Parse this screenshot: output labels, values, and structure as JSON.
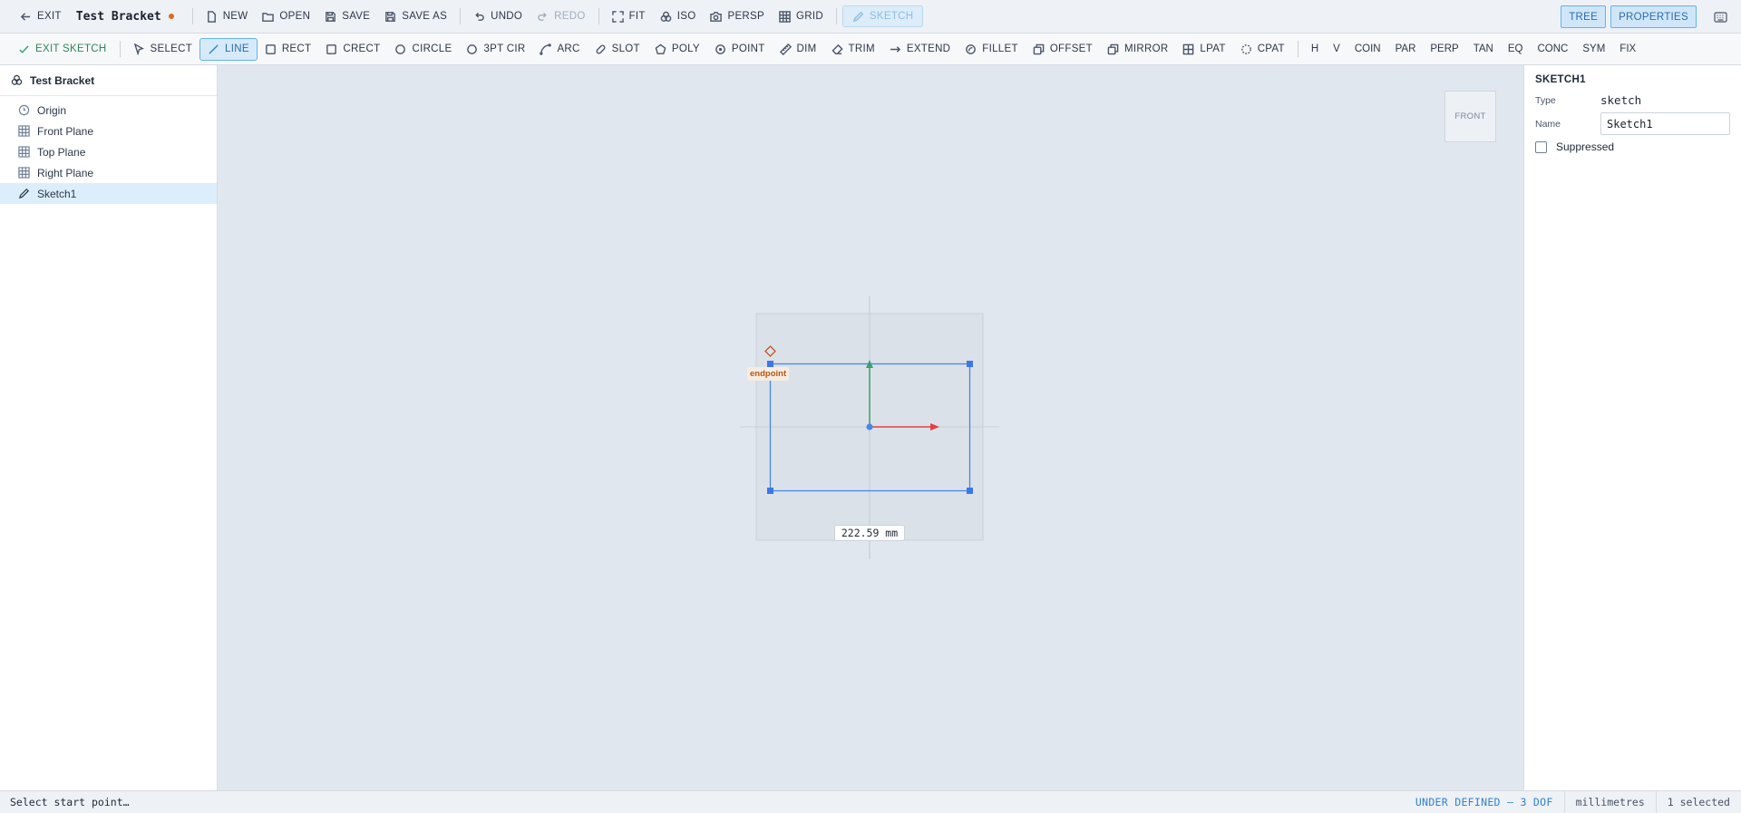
{
  "header": {
    "exit_label": "EXIT",
    "doc_title": "Test Bracket",
    "buttons": {
      "new": "NEW",
      "open": "OPEN",
      "save": "SAVE",
      "save_as": "SAVE AS",
      "undo": "UNDO",
      "redo": "REDO",
      "fit": "FIT",
      "iso": "ISO",
      "persp": "PERSP",
      "grid": "GRID",
      "sketch": "SKETCH"
    },
    "toggles": {
      "tree": "TREE",
      "properties": "PROPERTIES"
    }
  },
  "sketch_toolbar": {
    "exit_sketch": "EXIT SKETCH",
    "tools": {
      "select": "SELECT",
      "line": "LINE",
      "rect": "RECT",
      "crect": "CRECT",
      "circle": "CIRCLE",
      "3ptcir": "3PT CIR",
      "arc": "ARC",
      "slot": "SLOT",
      "poly": "POLY",
      "point": "POINT",
      "dim": "DIM",
      "trim": "TRIM",
      "extend": "EXTEND",
      "fillet": "FILLET",
      "offset": "OFFSET",
      "mirror": "MIRROR",
      "lpat": "LPAT",
      "cpat": "CPAT"
    },
    "active_tool": "LINE",
    "constraints": [
      "H",
      "V",
      "COIN",
      "PAR",
      "PERP",
      "TAN",
      "EQ",
      "CONC",
      "SYM",
      "FIX"
    ]
  },
  "tree": {
    "root": "Test Bracket",
    "items": [
      {
        "label": "Origin",
        "icon": "origin-icon"
      },
      {
        "label": "Front Plane",
        "icon": "plane-icon"
      },
      {
        "label": "Top Plane",
        "icon": "plane-icon"
      },
      {
        "label": "Right Plane",
        "icon": "plane-icon"
      },
      {
        "label": "Sketch1",
        "icon": "pencil-icon",
        "selected": true
      }
    ]
  },
  "viewport": {
    "view_cube": "FRONT",
    "snap_label": "endpoint",
    "dimension": "222.59 mm"
  },
  "properties": {
    "title": "SKETCH1",
    "type_label": "Type",
    "type_value": "sketch",
    "name_label": "Name",
    "name_value": "Sketch1",
    "suppressed_label": "Suppressed",
    "suppressed": false
  },
  "status": {
    "prompt": "Select start point…",
    "dof": "UNDER DEFINED — 3 DOF",
    "units": "millimetres",
    "selection": "1 selected"
  },
  "colors": {
    "accent": "#3182ce",
    "sketch_line": "#4a86e8",
    "x_axis": "#e53e3e",
    "y_axis": "#38a169",
    "snap": "#c05621",
    "dirty": "#dd6b20"
  }
}
